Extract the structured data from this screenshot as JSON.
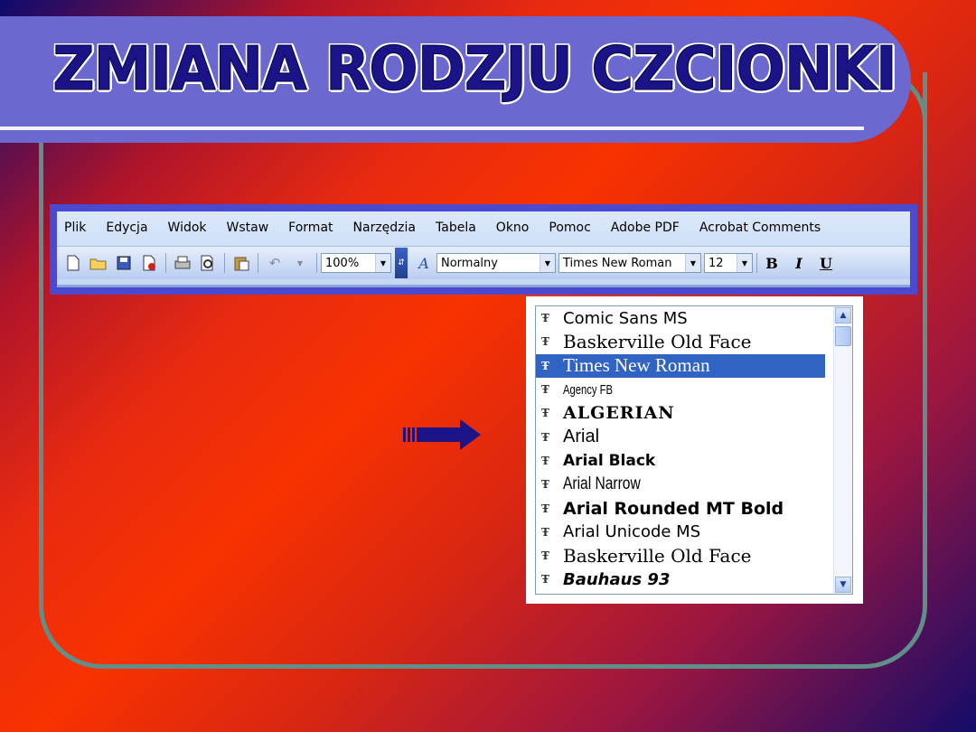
{
  "slide": {
    "title": "ZMIANA RODZJU CZCIONKI"
  },
  "menubar": {
    "items": [
      "Plik",
      "Edycja",
      "Widok",
      "Wstaw",
      "Format",
      "Narzędzia",
      "Tabela",
      "Okno",
      "Pomoc",
      "Adobe PDF",
      "Acrobat Comments"
    ]
  },
  "toolbar": {
    "zoom": "100%",
    "style": "Normalny",
    "font": "Times New Roman",
    "size": "12",
    "bold": "B",
    "italic": "I",
    "underline": "U",
    "icons": [
      "new-document-icon",
      "open-folder-icon",
      "save-icon",
      "permission-icon",
      "print-icon",
      "print-preview-icon",
      "paste-icon",
      "undo-icon"
    ]
  },
  "font_list": {
    "items": [
      "Comic Sans MS",
      "Baskerville Old Face",
      "Times New Roman",
      "Agency FB",
      "ALGERIAN",
      "Arial",
      "Arial Black",
      "Arial Narrow",
      "Arial Rounded MT Bold",
      "Arial Unicode MS",
      "Baskerville Old Face",
      "Bauhaus 93"
    ],
    "selected": "Times New Roman",
    "icon": "truetype-icon"
  },
  "colors": {
    "title_bar": "#6b68d0",
    "title_text": "#1a1488",
    "frame": "#5f8f88",
    "selection": "#3163c5",
    "arrow": "#1a1488"
  }
}
